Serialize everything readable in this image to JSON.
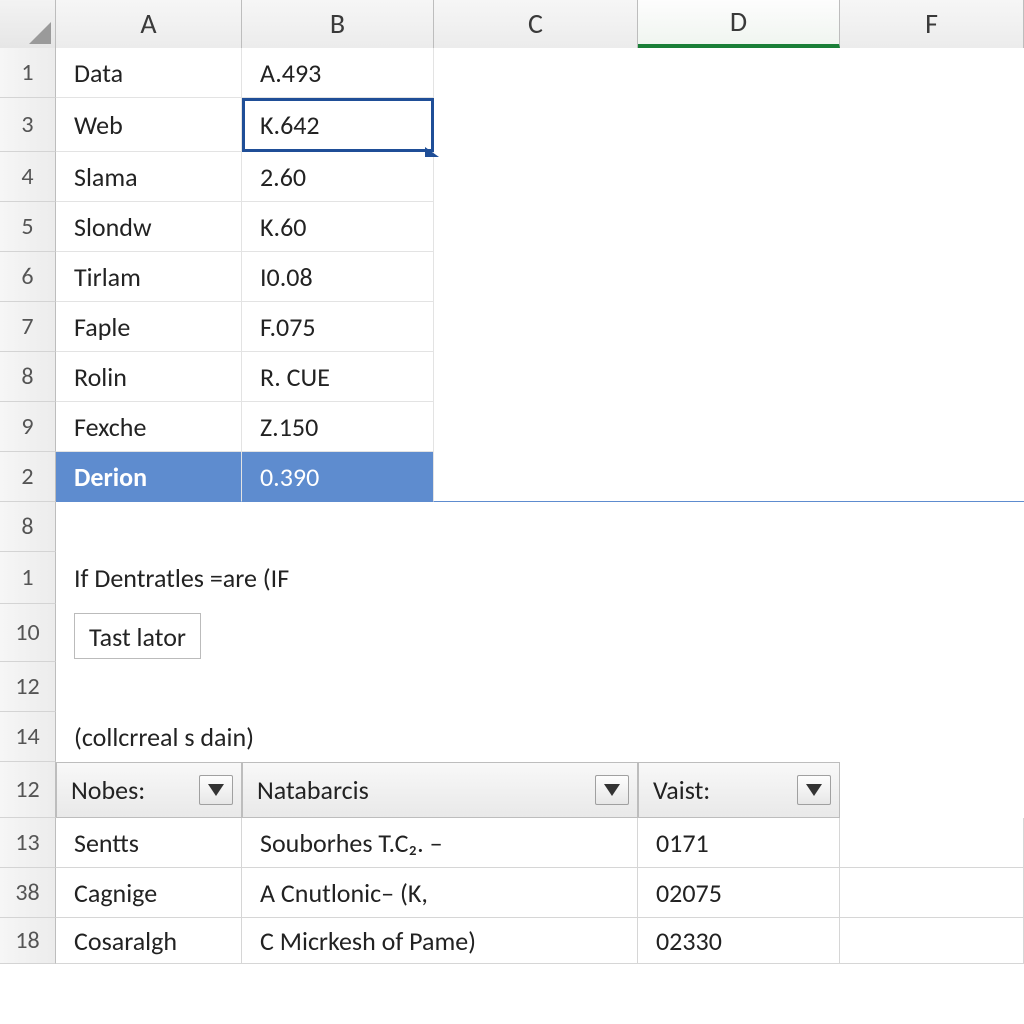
{
  "columns": [
    "A",
    "B",
    "C",
    "D",
    "F"
  ],
  "active_column": "D",
  "top_table": {
    "row_headers": [
      "1",
      "3",
      "4",
      "5",
      "6",
      "7",
      "8",
      "9",
      "2"
    ],
    "rows": [
      {
        "a": "Data",
        "b": "A.493"
      },
      {
        "a": "Web",
        "b": "K.642"
      },
      {
        "a": "Slama",
        "b": "2.60"
      },
      {
        "a": "Slondw",
        "b": "K.60"
      },
      {
        "a": "Tirlam",
        "b": "I0.08"
      },
      {
        "a": "Faple",
        "b": "F.075"
      },
      {
        "a": "Rolin",
        "b": "R. CUE"
      },
      {
        "a": "Fexche",
        "b": "Z.150"
      },
      {
        "a": "Derion",
        "b": "0.390"
      }
    ],
    "highlight_row_index": 8,
    "selected_cell_row_index": 1
  },
  "mid": {
    "row_headers_after": [
      "8",
      "1",
      "10",
      "12",
      "14"
    ],
    "formula_text": "If Dentratles =are  (IF",
    "button_label": "Tast lator",
    "paren_text": "(collcrreal s dain)"
  },
  "filter_table": {
    "header_row_num": "12",
    "cols": [
      {
        "label": "Nobes:"
      },
      {
        "label": "Natabarcis"
      },
      {
        "label": "Vaist:"
      }
    ],
    "rows": [
      {
        "num": "13",
        "a": "Sentts",
        "b": "Souborhes T.C₂. –",
        "c": "0171"
      },
      {
        "num": "38",
        "a": "Cagnige",
        "b": "A Cnutlonic– (K,",
        "c": "02075"
      },
      {
        "num": "18",
        "a": "Cosaralgh",
        "b": "C Micrkesh of Pame)",
        "c": "02330"
      }
    ]
  }
}
